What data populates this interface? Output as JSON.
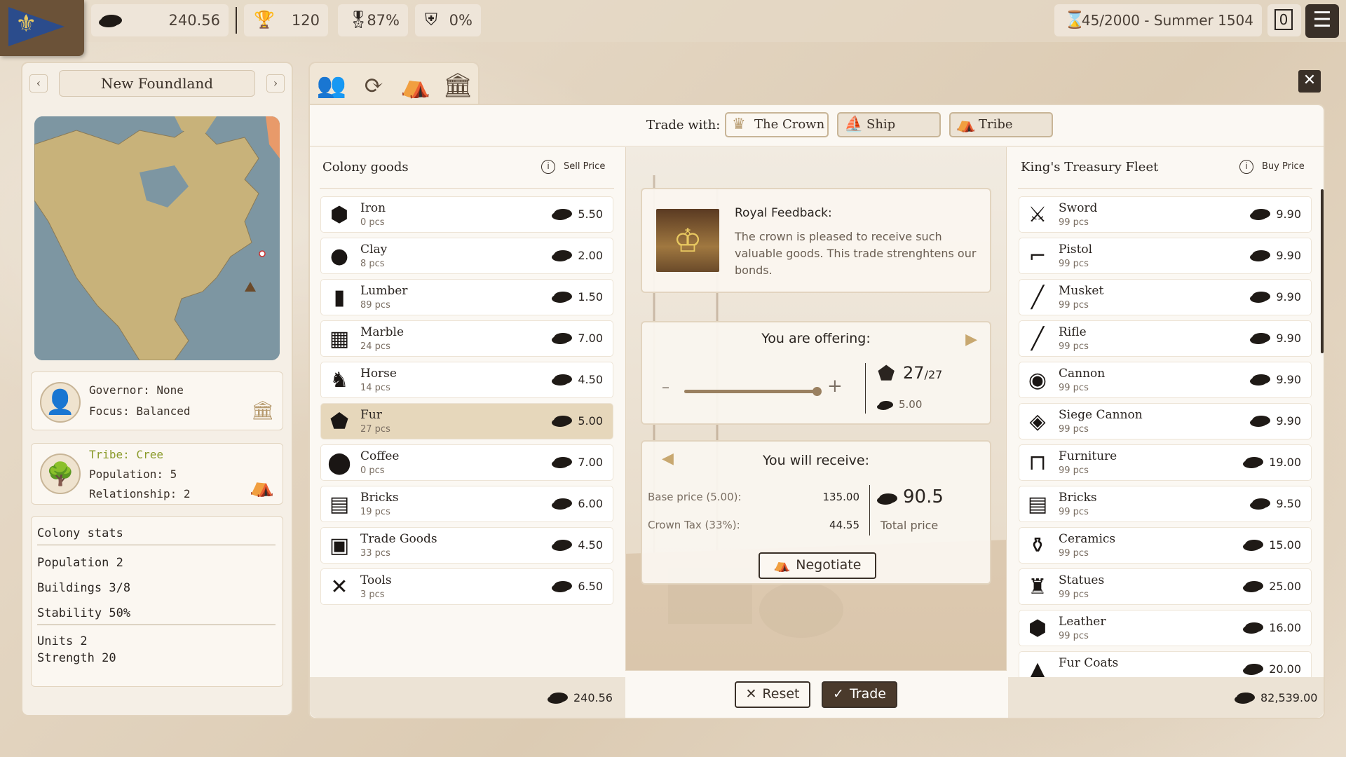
{
  "top": {
    "gold": "240.56",
    "prestige": "120",
    "approval": "87%",
    "unrest": "0%",
    "date": "45/2000 - Summer 1504",
    "notifications": "0"
  },
  "colony": {
    "name": "New Foundland",
    "governor": "Governor: None",
    "focus": "Focus: Balanced",
    "tribe": "Tribe: Cree",
    "population": "Population: 5",
    "relationship": "Relationship: 2",
    "stats_title": "Colony stats",
    "stat_pop": "Population 2",
    "stat_buildings": "Buildings 3/8",
    "stat_stability": "Stability 50%",
    "stat_units": "Units 2",
    "stat_strength": "Strength 20"
  },
  "trade_with": {
    "label": "Trade with:",
    "crown": "The Crown",
    "ship": "Ship",
    "tribe": "Tribe"
  },
  "left_list": {
    "title": "Colony goods",
    "price_header": "Sell Price",
    "footer_total": "240.56",
    "items": [
      {
        "name": "Iron",
        "qty": "0 pcs",
        "price": "5.50",
        "icon": "iron-icon",
        "glyph": "⬢"
      },
      {
        "name": "Clay",
        "qty": "8 pcs",
        "price": "2.00",
        "icon": "clay-icon",
        "glyph": "●"
      },
      {
        "name": "Lumber",
        "qty": "89 pcs",
        "price": "1.50",
        "icon": "lumber-icon",
        "glyph": "▮"
      },
      {
        "name": "Marble",
        "qty": "24 pcs",
        "price": "7.00",
        "icon": "marble-icon",
        "glyph": "▦"
      },
      {
        "name": "Horse",
        "qty": "14 pcs",
        "price": "4.50",
        "icon": "horse-icon",
        "glyph": "♞"
      },
      {
        "name": "Fur",
        "qty": "27 pcs",
        "price": "5.00",
        "icon": "fur-icon",
        "glyph": "⬟"
      },
      {
        "name": "Coffee",
        "qty": "0 pcs",
        "price": "7.00",
        "icon": "coffee-icon",
        "glyph": "⬤"
      },
      {
        "name": "Bricks",
        "qty": "19 pcs",
        "price": "6.00",
        "icon": "bricks-icon",
        "glyph": "▤"
      },
      {
        "name": "Trade Goods",
        "qty": "33 pcs",
        "price": "4.50",
        "icon": "trade-goods-icon",
        "glyph": "▣"
      },
      {
        "name": "Tools",
        "qty": "3 pcs",
        "price": "6.50",
        "icon": "tools-icon",
        "glyph": "✕"
      }
    ]
  },
  "right_list": {
    "title": "King's Treasury Fleet",
    "price_header": "Buy Price",
    "footer_total": "82,539.00",
    "items": [
      {
        "name": "Sword",
        "qty": "99 pcs",
        "price": "9.90",
        "icon": "sword-icon",
        "glyph": "⚔"
      },
      {
        "name": "Pistol",
        "qty": "99 pcs",
        "price": "9.90",
        "icon": "pistol-icon",
        "glyph": "⌐"
      },
      {
        "name": "Musket",
        "qty": "99 pcs",
        "price": "9.90",
        "icon": "musket-icon",
        "glyph": "╱"
      },
      {
        "name": "Rifle",
        "qty": "99 pcs",
        "price": "9.90",
        "icon": "rifle-icon",
        "glyph": "╱"
      },
      {
        "name": "Cannon",
        "qty": "99 pcs",
        "price": "9.90",
        "icon": "cannon-icon",
        "glyph": "◉"
      },
      {
        "name": "Siege Cannon",
        "qty": "99 pcs",
        "price": "9.90",
        "icon": "siege-cannon-icon",
        "glyph": "◈"
      },
      {
        "name": "Furniture",
        "qty": "99 pcs",
        "price": "19.00",
        "icon": "furniture-icon",
        "glyph": "⊓"
      },
      {
        "name": "Bricks",
        "qty": "99 pcs",
        "price": "9.50",
        "icon": "bricks-icon",
        "glyph": "▤"
      },
      {
        "name": "Ceramics",
        "qty": "99 pcs",
        "price": "15.00",
        "icon": "ceramics-icon",
        "glyph": "⚱"
      },
      {
        "name": "Statues",
        "qty": "99 pcs",
        "price": "25.00",
        "icon": "statues-icon",
        "glyph": "♜"
      },
      {
        "name": "Leather",
        "qty": "99 pcs",
        "price": "16.00",
        "icon": "leather-icon",
        "glyph": "⬢"
      },
      {
        "name": "Fur Coats",
        "qty": "",
        "price": "20.00",
        "icon": "fur-coats-icon",
        "glyph": "▲"
      }
    ]
  },
  "feedback": {
    "title": "Royal Feedback:",
    "text": "The crown is pleased to receive such valuable goods. This trade strenghtens our bonds."
  },
  "offer": {
    "title": "You are offering:",
    "qty": "27",
    "max": "/27",
    "unit_price": "5.00",
    "slider_fraction": 1.0
  },
  "receive": {
    "title": "You will receive:",
    "base_label": "Base price (5.00):",
    "base_value": "135.00",
    "tax_label": "Crown Tax (33%):",
    "tax_value": "44.55",
    "total": "90.5",
    "total_label": "Total price",
    "negotiate": "Negotiate"
  },
  "actions": {
    "reset": "Reset",
    "trade": "Trade"
  }
}
